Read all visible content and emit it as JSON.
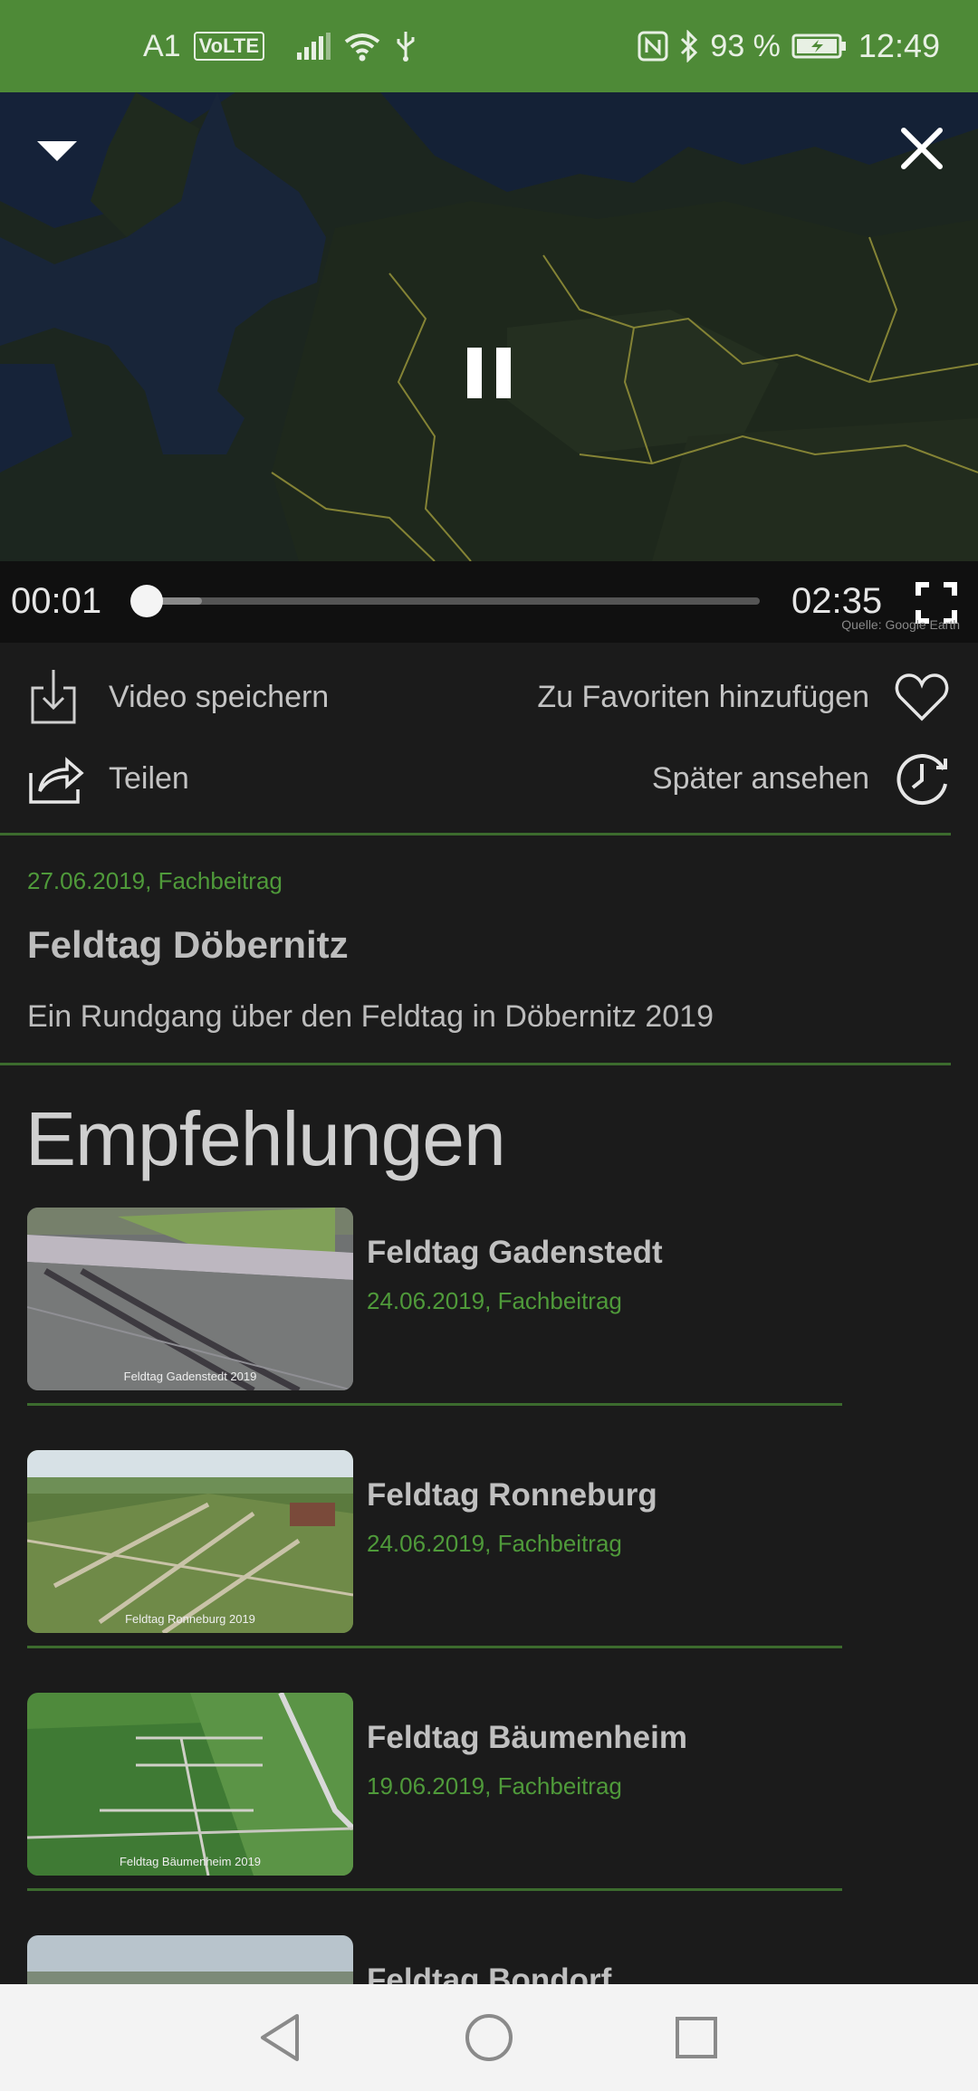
{
  "status_bar": {
    "carrier": "A1",
    "volte": "VoLTE",
    "battery": "93 %",
    "time": "12:49"
  },
  "player": {
    "current_time": "00:01",
    "duration": "02:35",
    "progress_fraction": 0.01,
    "buffered_fraction": 0.1,
    "credit": "Quelle: Google Earth"
  },
  "actions": {
    "save_video": "Video speichern",
    "add_favorite": "Zu Favoriten hinzufügen",
    "share": "Teilen",
    "watch_later": "Später ansehen"
  },
  "video": {
    "meta": "27.06.2019, Fachbeitrag",
    "title": "Feldtag Döbernitz",
    "description": "Ein Rundgang über den Feldtag in Döbernitz 2019"
  },
  "recommendations": {
    "heading": "Empfehlungen",
    "items": [
      {
        "title": "Feldtag Gadenstedt",
        "meta": "24.06.2019, Fachbeitrag",
        "caption": "Feldtag Gadenstedt 2019"
      },
      {
        "title": "Feldtag Ronneburg",
        "meta": "24.06.2019, Fachbeitrag",
        "caption": "Feldtag Ronneburg 2019"
      },
      {
        "title": "Feldtag Bäumenheim",
        "meta": "19.06.2019, Fachbeitrag",
        "caption": "Feldtag Bäumenheim 2019"
      },
      {
        "title": "Feldtag Bondorf",
        "meta": "",
        "caption": ""
      }
    ]
  },
  "colors": {
    "accent": "#4e8a37",
    "background": "#1b1b1b",
    "meta_text": "#4f9a3a"
  }
}
